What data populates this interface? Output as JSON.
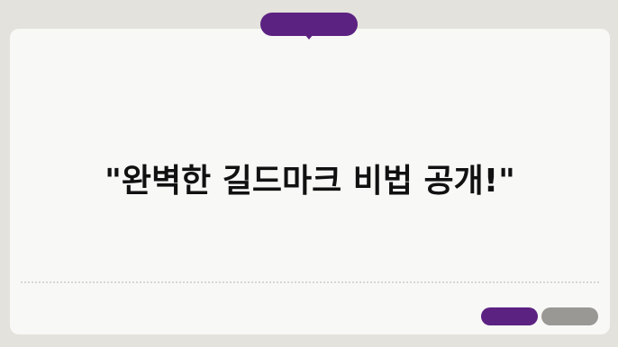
{
  "headline": {
    "text": "\"완벽한 길드마크 비법 공개!\""
  },
  "colors": {
    "background": "#e4e2dc",
    "card": "#f8f8f6",
    "accent_purple": "#5b2282",
    "accent_gray": "#9a9895",
    "text": "#111111"
  }
}
